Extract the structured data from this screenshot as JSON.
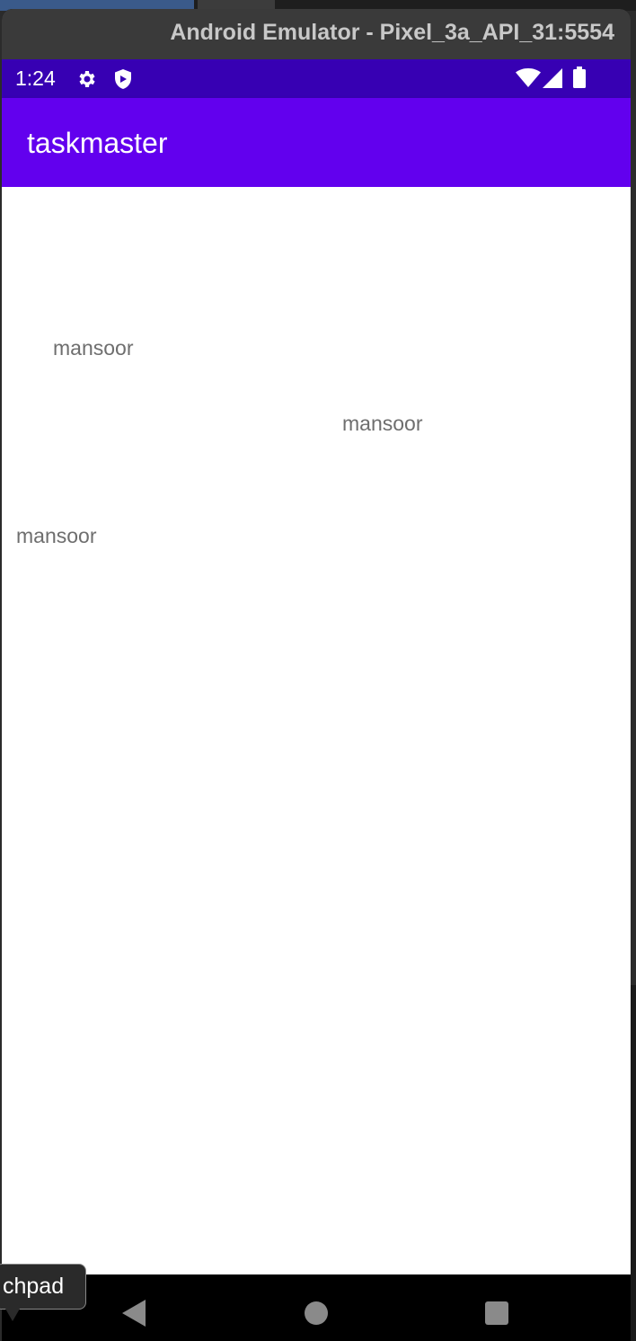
{
  "window": {
    "title": "Android Emulator - Pixel_3a_API_31:5554"
  },
  "status_bar": {
    "time": "1:24",
    "icons": [
      "gear-icon",
      "shield-icon",
      "wifi-icon",
      "signal-icon",
      "battery-icon"
    ]
  },
  "app_bar": {
    "title": "taskmaster",
    "color": "#6200ee",
    "status_color": "#3700b3"
  },
  "content": {
    "labels": [
      "mansoor",
      "mansoor",
      "mansoor"
    ]
  },
  "nav_bar": {
    "icons": [
      "back-icon",
      "home-icon",
      "recents-icon"
    ]
  },
  "tooltip": {
    "text": "chpad"
  }
}
